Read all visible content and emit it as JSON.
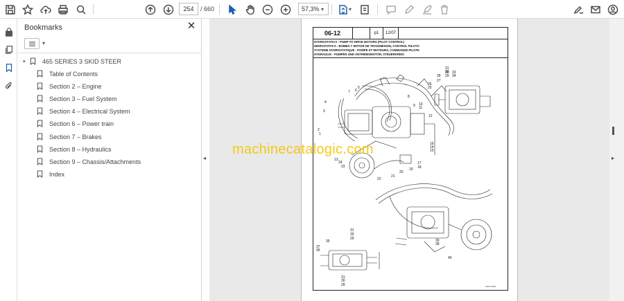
{
  "toolbar": {
    "current_page": "254",
    "total_pages": "/ 660",
    "zoom": "57,3%"
  },
  "panel": {
    "title": "Bookmarks",
    "close_glyph": "✕",
    "root": "465 SERIES 3 SKID STEER",
    "items": [
      {
        "label": "Table of Contents"
      },
      {
        "label": "Section 2 – Engine"
      },
      {
        "label": "Section 3 – Fuel System"
      },
      {
        "label": "Section 4 – Electrical System"
      },
      {
        "label": "Section 6 – Power train"
      },
      {
        "label": "Section 7 – Brakes"
      },
      {
        "label": "Section 8 – Hydraulics"
      },
      {
        "label": "Section 9 – Chassis/Attachments"
      },
      {
        "label": "Index"
      }
    ]
  },
  "document": {
    "section_code": "06-12",
    "page_ref": "p1",
    "date": "12/07",
    "titles": [
      "HYDROSTATICS - PUMP TO DRIVE MOTORS (PILOT CONTROL)",
      "HIDROSTATICA - BOMBA Y MOTOR DE TRANSMISION, CONTROL PILOTO",
      "SYSTEME HYDROSTATIQUE - POMPE ET MOTEURS, COMMANDE PILOTE",
      "HYDRAULIK - PUMPEN UND ANTRIEBSMOTOR, STEUERKREIS"
    ],
    "callouts_top": [
      "1",
      "2",
      "3",
      "4",
      "5",
      "6",
      "7",
      "8",
      "9",
      "10",
      "11",
      "12",
      "13",
      "14",
      "15",
      "16",
      "17",
      "18",
      "19",
      "20",
      "21",
      "22",
      "23",
      "24",
      "25",
      "26",
      "27",
      "28",
      "29",
      "30",
      "31",
      "32",
      "33",
      "34"
    ],
    "callouts_bottom": [
      "28",
      "29",
      "30",
      "31",
      "35",
      "36",
      "37",
      "38",
      "39",
      "40"
    ],
    "watermark": "machinecatalogic.com",
    "figure_code": "S06-P1829"
  }
}
